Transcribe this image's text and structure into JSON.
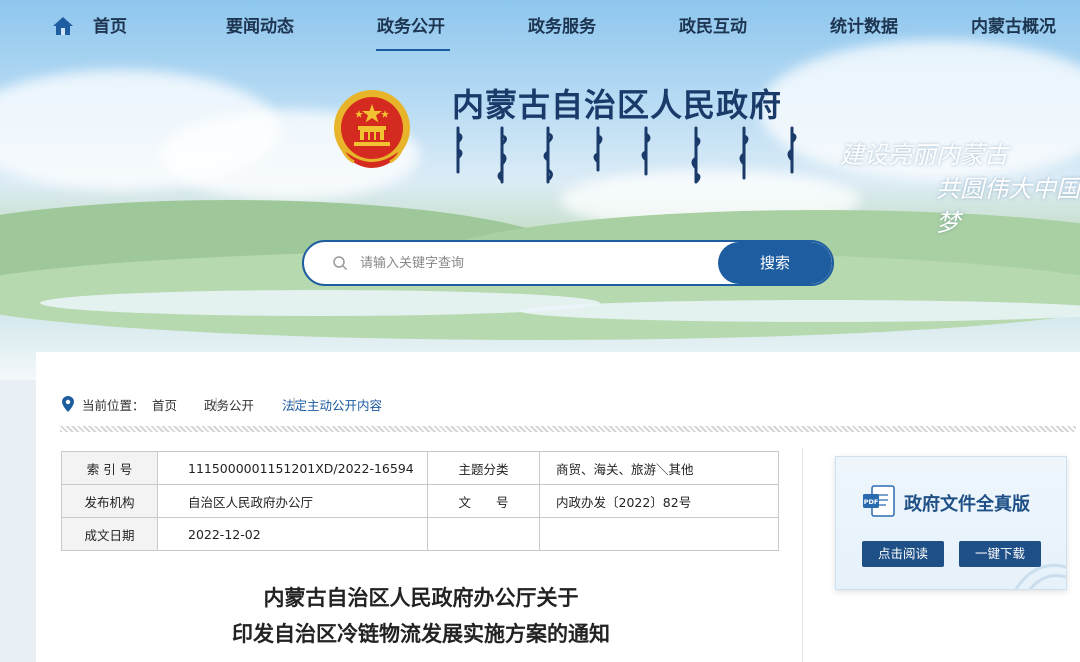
{
  "nav": {
    "items": [
      {
        "label": "首页"
      },
      {
        "label": "要闻动态"
      },
      {
        "label": "政务公开"
      },
      {
        "label": "政务服务"
      },
      {
        "label": "政民互动"
      },
      {
        "label": "统计数据"
      },
      {
        "label": "内蒙古概况"
      }
    ],
    "active": "政务公开",
    "icon": "home-icon"
  },
  "header": {
    "site_title": "内蒙古自治区人民政府",
    "slogan_line1": "建设亮丽内蒙古",
    "slogan_line2": "共圆伟大中国梦"
  },
  "search": {
    "placeholder": "请输入关键字查询",
    "button_label": "搜索"
  },
  "breadcrumb": {
    "label": "当前位置：",
    "items": [
      "首页",
      "政务公开",
      "法定主动公开内容"
    ]
  },
  "meta_table": {
    "rows": [
      {
        "label1": "索 引 号",
        "value1": "11150000011512​01XD/2022-16594",
        "label2": "主题分类",
        "value2": "商贸、海关、旅游＼其他"
      },
      {
        "label1": "发布机构",
        "value1": "自治区人民政府办公厅",
        "label2": "文　　号",
        "value2": "内政办发〔2022〕82号"
      },
      {
        "label1": "成文日期",
        "value1": "2022-12-02",
        "label2": "",
        "value2": ""
      }
    ]
  },
  "document": {
    "title_line1": "内蒙古自治区人民政府办公厅关于",
    "title_line2": "印发自治区冷链物流发展实施方案的通知"
  },
  "side_panel": {
    "title": "政府文件全真版",
    "read_button": "点击阅读",
    "download_button": "一键下载"
  },
  "colors": {
    "primary": "#1e5da0",
    "nav_text": "#1d3550",
    "title": "#1a3a6a"
  }
}
